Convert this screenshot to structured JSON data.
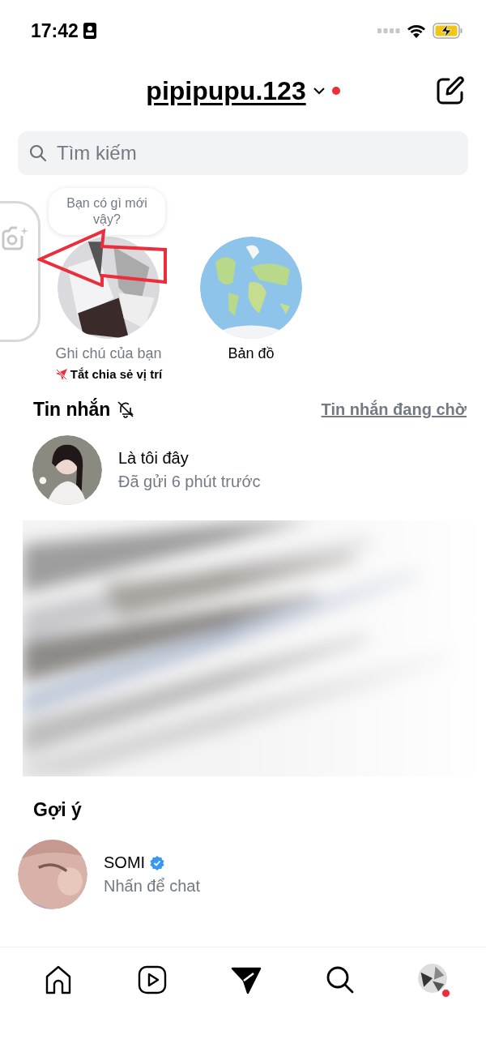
{
  "status_bar": {
    "time": "17:42"
  },
  "header": {
    "username": "pipipupu.123",
    "has_notification": true
  },
  "search": {
    "placeholder": "Tìm kiếm"
  },
  "notes": [
    {
      "kind": "own",
      "bubble": "Bạn có gì mới vậy?",
      "label": "Ghi chú của bạn",
      "sublabel": "Tắt chia sẻ vị trí"
    },
    {
      "kind": "map",
      "label": "Bản đồ"
    }
  ],
  "messages": {
    "title": "Tin nhắn",
    "muted": true,
    "requests_link": "Tin nhắn đang chờ",
    "threads": [
      {
        "name": "Là tôi đây",
        "preview": "Đã gửi 6 phút trước"
      }
    ]
  },
  "suggestions": {
    "title": "Gợi ý",
    "items": [
      {
        "name": "SOMI",
        "verified": true,
        "subtitle": "Nhấn để chat"
      }
    ]
  },
  "tab_bar": [
    {
      "kind": "home",
      "selected": false
    },
    {
      "kind": "reels",
      "selected": false
    },
    {
      "kind": "messages",
      "selected": true
    },
    {
      "kind": "search",
      "selected": false
    },
    {
      "kind": "profile",
      "selected": false,
      "badge": true
    }
  ]
}
